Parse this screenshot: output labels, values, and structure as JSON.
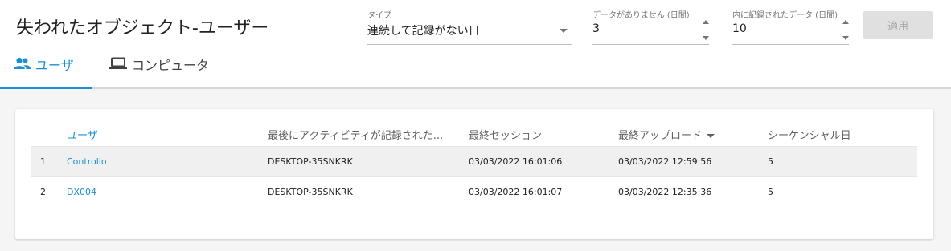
{
  "header": {
    "title": "失われたオブジェクト-ユーザー",
    "type_field": {
      "label": "タイプ",
      "value": "連続して記録がない日"
    },
    "days_without_data": {
      "label": "データがありません (日間)",
      "value": "3"
    },
    "days_within_data": {
      "label": "内に記録されたデータ (日間)",
      "value": "10"
    },
    "apply_label": "適用"
  },
  "tabs": [
    {
      "label": "ユーザ",
      "icon": "users-icon",
      "active": true
    },
    {
      "label": "コンピュータ",
      "icon": "laptop-icon",
      "active": false
    }
  ],
  "table": {
    "columns": [
      "ユーザ",
      "最後にアクティビティが記録された...",
      "最終セッション",
      "最終アップロード",
      "シーケンシャル日"
    ],
    "sorted_column": "最終アップロード",
    "rows": [
      {
        "index": "1",
        "user": "Controlio",
        "computer": "DESKTOP-35SNKRK",
        "last_session": "03/03/2022 16:01:06",
        "last_upload": "03/03/2022 12:59:56",
        "sequential_days": "5"
      },
      {
        "index": "2",
        "user": "DX004",
        "computer": "DESKTOP-35SNKRK",
        "last_session": "03/03/2022 16:01:07",
        "last_upload": "03/03/2022 12:35:36",
        "sequential_days": "5"
      }
    ]
  },
  "colors": {
    "accent": "#1a8fd1",
    "disabled_button": "#e0e0e0"
  }
}
